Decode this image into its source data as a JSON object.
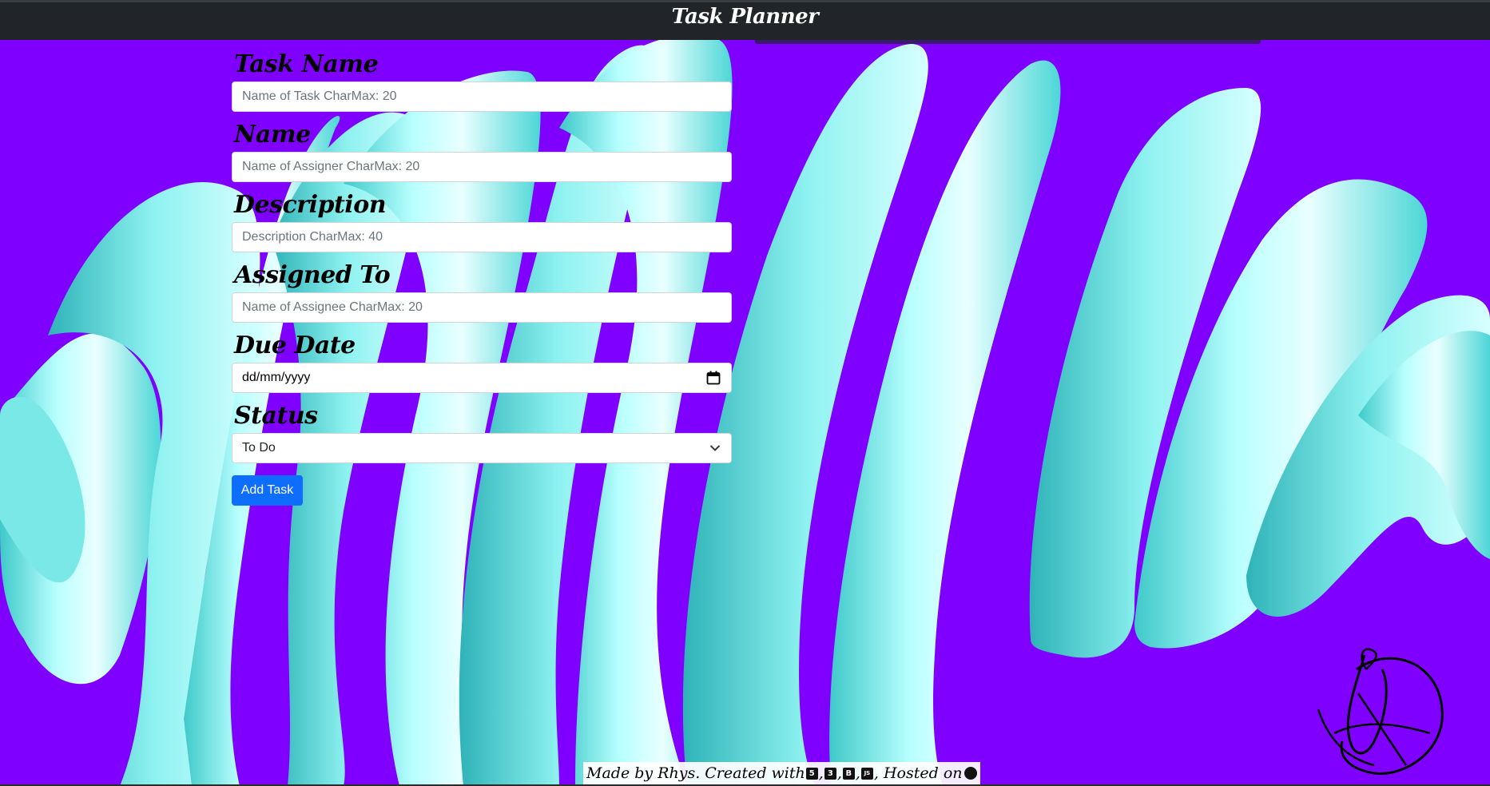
{
  "app": {
    "title": "Task Planner"
  },
  "form": {
    "task_name": {
      "label": "Task Name",
      "placeholder": "Name of Task CharMax: 20"
    },
    "name": {
      "label": "Name",
      "placeholder": "Name of Assigner CharMax: 20"
    },
    "description": {
      "label": "Description",
      "placeholder": "Description CharMax: 40"
    },
    "assigned_to": {
      "label": "Assigned To",
      "placeholder": "Name of Assignee CharMax: 20"
    },
    "due_date": {
      "label": "Due Date",
      "value": "dd/mm/yyyy",
      "icon": "calendar-icon"
    },
    "status": {
      "label": "Status",
      "selected": "To Do",
      "icon": "chevron-down-icon"
    },
    "submit_label": "Add Task"
  },
  "footer": {
    "made_by": "Made by Rhys. Created with",
    "hosted": ", Hosted on",
    "icons": [
      "html5-icon",
      "css3-icon",
      "bootstrap-icon",
      "javascript-icon",
      "github-icon"
    ],
    "icon_glyphs": {
      "html": "5",
      "css": "3",
      "bootstrap": "B",
      "js": "JS"
    }
  },
  "colors": {
    "background": "#7f00ff",
    "ribbon": "#7ff0ee",
    "navbar": "#212529",
    "button": "#0d6efd"
  }
}
